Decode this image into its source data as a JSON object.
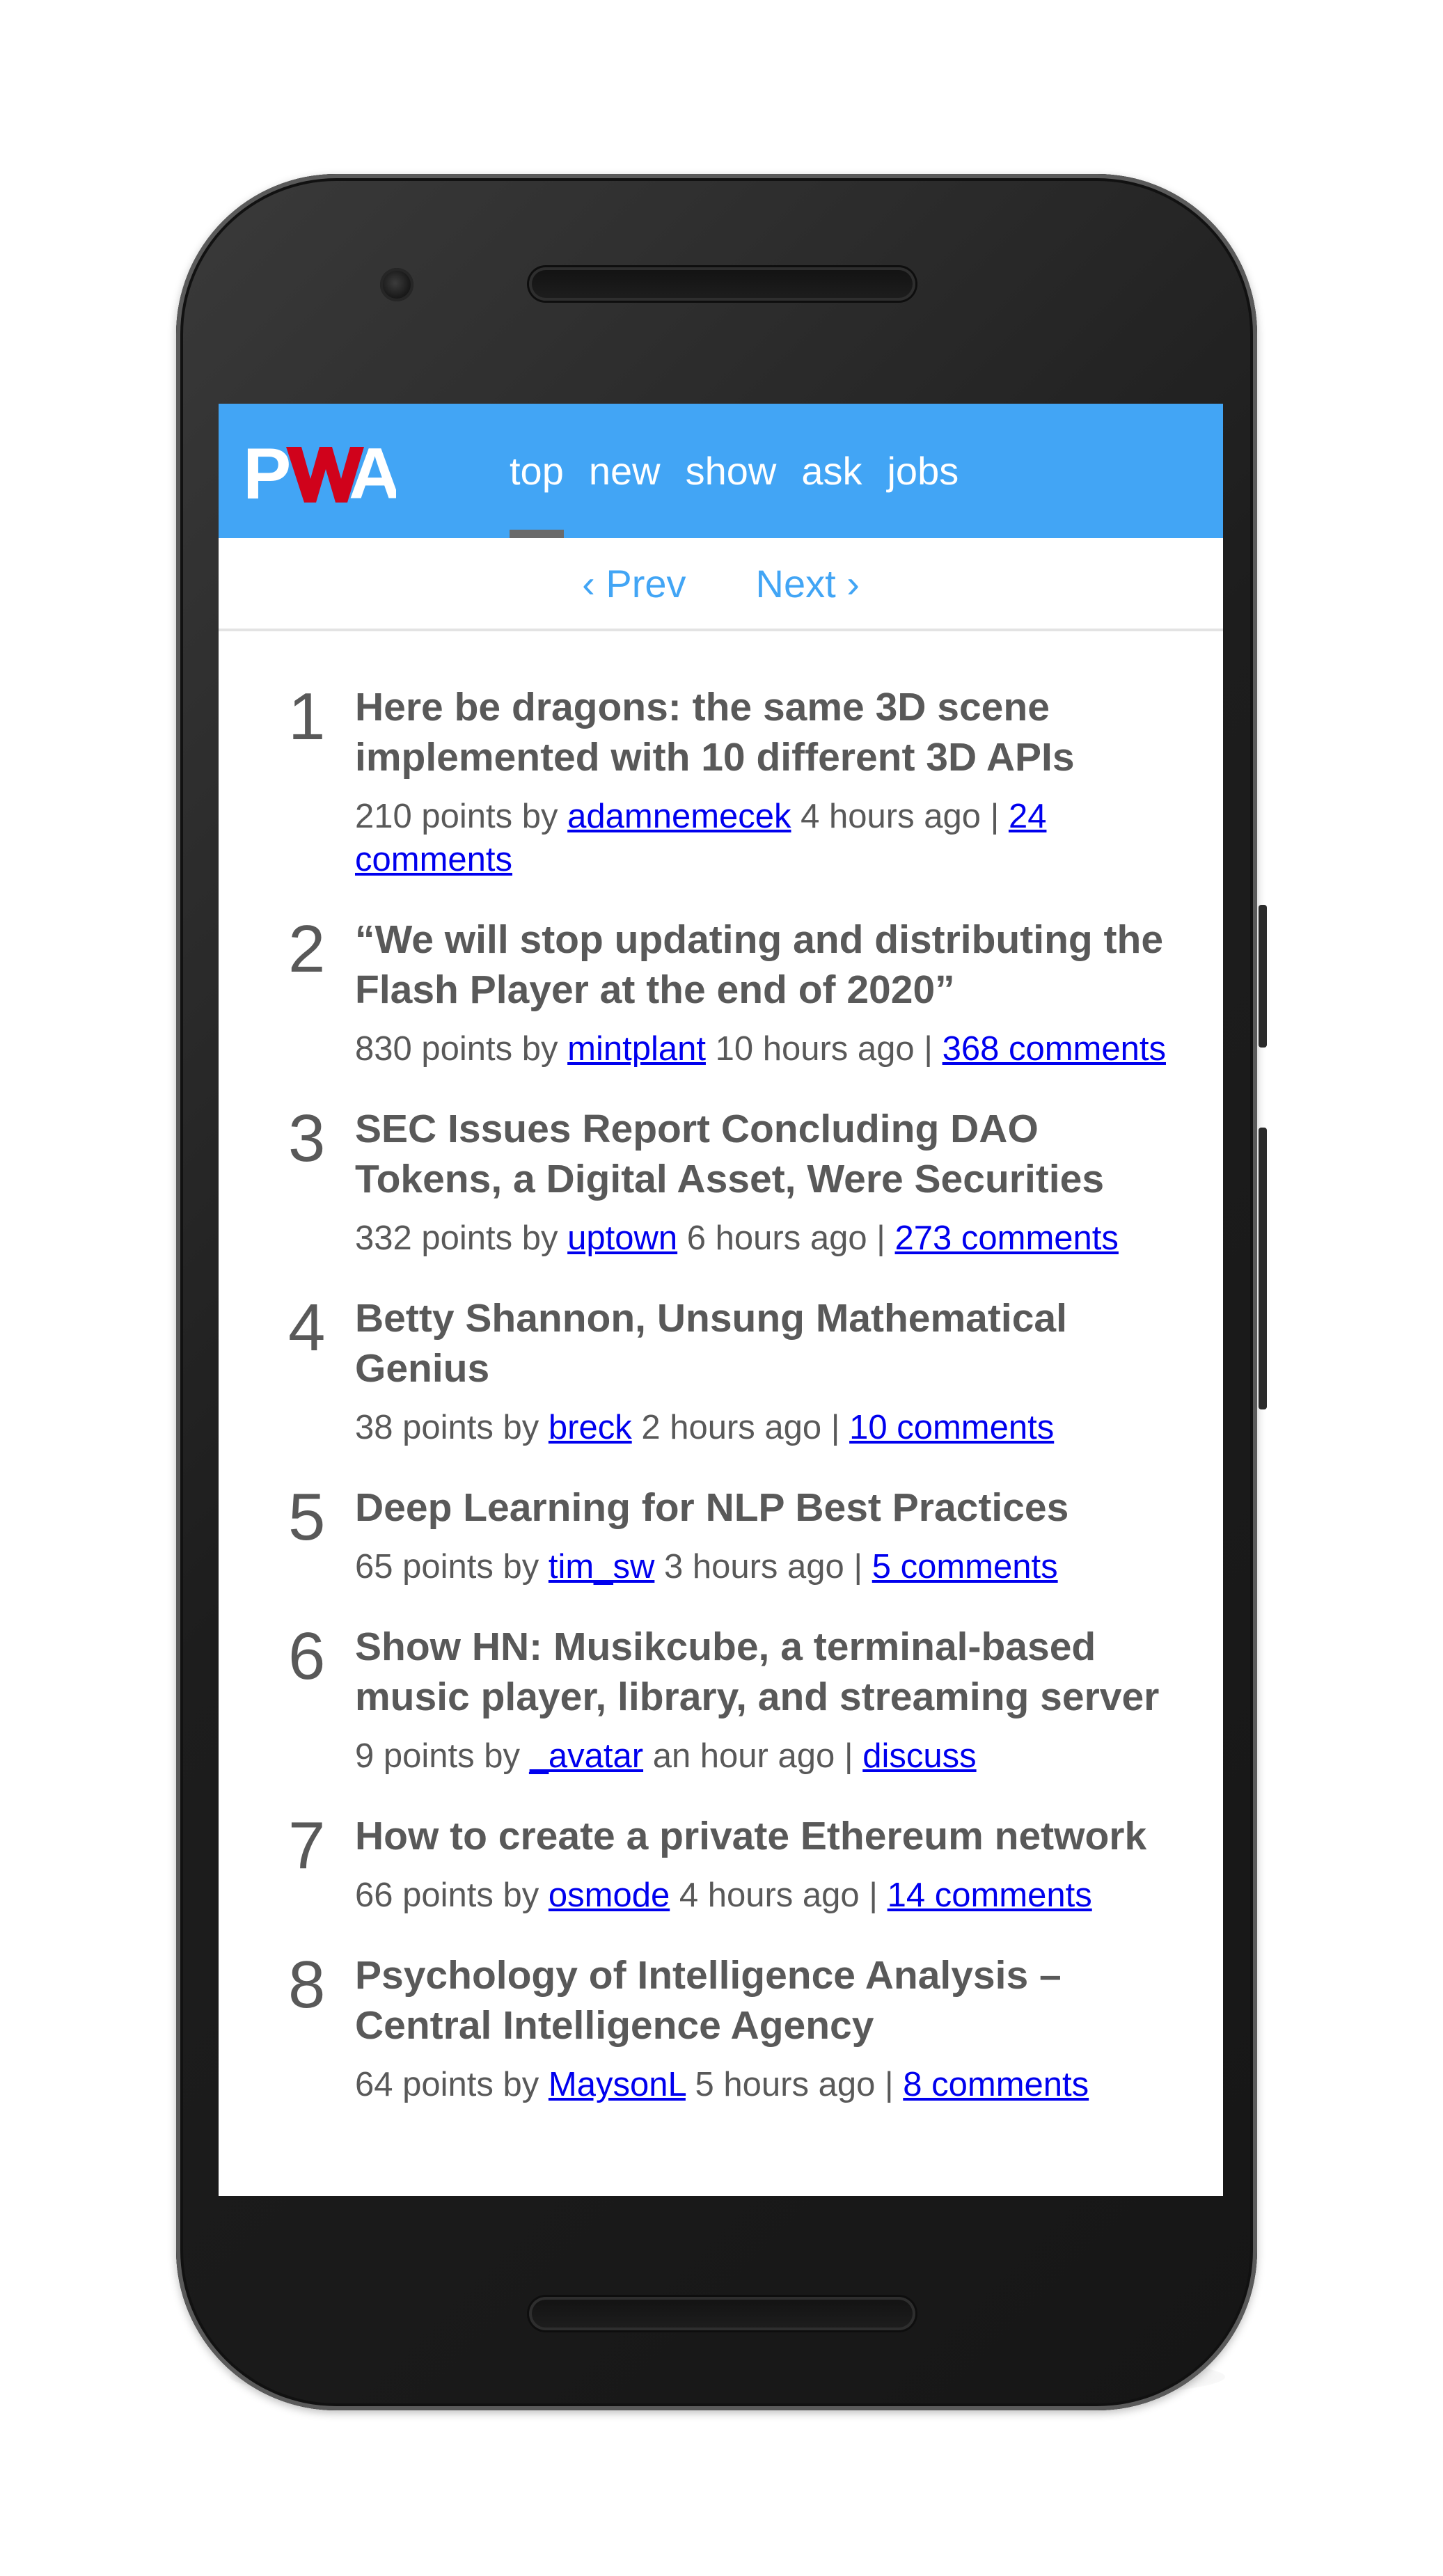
{
  "app": {
    "logo_text": "PWA",
    "brand_color": "#42a5f5",
    "logo_accent_color": "#d0021b"
  },
  "nav": {
    "items": [
      {
        "label": "top",
        "active": true
      },
      {
        "label": "new",
        "active": false
      },
      {
        "label": "show",
        "active": false
      },
      {
        "label": "ask",
        "active": false
      },
      {
        "label": "jobs",
        "active": false
      }
    ]
  },
  "pager": {
    "prev": "‹ Prev",
    "next": "Next ›"
  },
  "stories": [
    {
      "rank": "1",
      "title": "Here be dragons: the same 3D scene implemented with 10 different 3D APIs",
      "points": "210 points by",
      "author": "adamnemecek",
      "time": "4 hours ago |",
      "comments": "24 comments"
    },
    {
      "rank": "2",
      "title": "“We will stop updating and distributing the Flash Player at the end of 2020”",
      "points": "830 points by",
      "author": "mintplant",
      "time": "10 hours ago |",
      "comments": "368 comments"
    },
    {
      "rank": "3",
      "title": "SEC Issues Report Concluding DAO Tokens, a Digital Asset, Were Securities",
      "points": "332 points by",
      "author": "uptown",
      "time": "6 hours ago |",
      "comments": "273 comments"
    },
    {
      "rank": "4",
      "title": "Betty Shannon, Unsung Mathematical Genius",
      "points": "38 points by",
      "author": "breck",
      "time": "2 hours ago |",
      "comments": "10 comments"
    },
    {
      "rank": "5",
      "title": "Deep Learning for NLP Best Practices",
      "points": "65 points by",
      "author": "tim_sw",
      "time": "3 hours ago |",
      "comments": "5 comments"
    },
    {
      "rank": "6",
      "title": "Show HN: Musikcube, a terminal-based music player, library, and streaming server",
      "points": "9 points by",
      "author": "_avatar",
      "time": "an hour ago |",
      "comments": "discuss"
    },
    {
      "rank": "7",
      "title": "How to create a private Ethereum network",
      "points": "66 points by",
      "author": "osmode",
      "time": "4 hours ago |",
      "comments": "14 comments"
    },
    {
      "rank": "8",
      "title": "Psychology of Intelligence Analysis – Central Intelligence Agency",
      "points": "64 points by",
      "author": "MaysonL",
      "time": "5 hours ago |",
      "comments": "8 comments"
    }
  ]
}
